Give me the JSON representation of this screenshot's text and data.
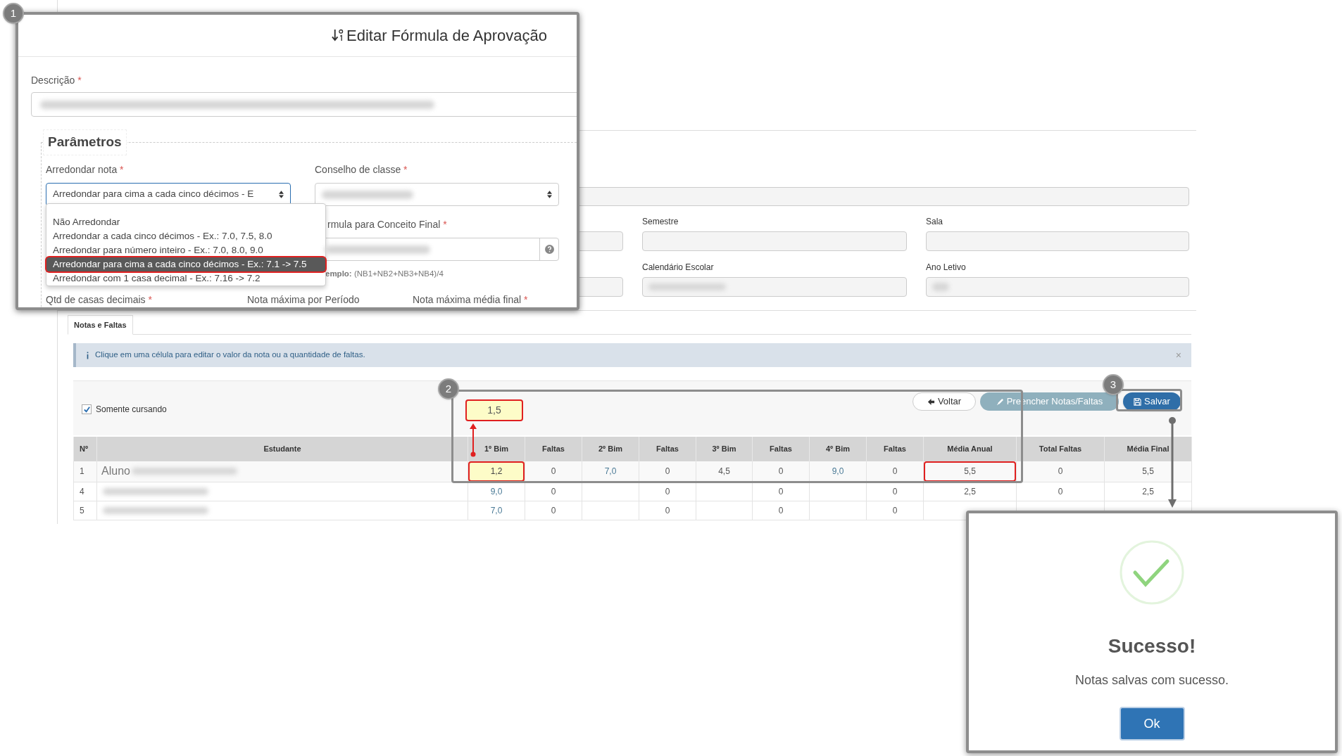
{
  "formula_dialog": {
    "badge": "1",
    "title": "Editar Fórmula de Aprovação",
    "description": {
      "label": "Descrição",
      "required_mark": "*"
    },
    "fieldset": "Parâmetros",
    "rounding": {
      "label": "Arredondar nota",
      "required_mark": "*",
      "value": "Arredondar para cima a cada cinco décimos - E",
      "options": [
        {
          "label": "Não Arredondar",
          "selected": false
        },
        {
          "label": "Arredondar a cada cinco décimos - Ex.: 7.0, 7.5, 8.0",
          "selected": false
        },
        {
          "label": "Arredondar para número inteiro - Ex.: 7.0, 8.0, 9.0",
          "selected": false
        },
        {
          "label": "Arredondar para cima a cada cinco décimos - Ex.: 7.1 -> 7.5",
          "selected": true
        },
        {
          "label": "Arredondar com 1 casa decimal - Ex.: 7.16 -> 7.2",
          "selected": false
        }
      ]
    },
    "class_council": {
      "label": "Conselho de classe",
      "required_mark": "*"
    },
    "final_formula": {
      "label": "rmula para Conceito Final",
      "required_mark": "*",
      "hint": "**emplo:** (NB1+NB2+NB3+NB4)/4"
    },
    "bottom_labels": [
      {
        "label": "Qtd de casas decimais",
        "required_mark": "*"
      },
      {
        "label": "Nota máxima por Período"
      },
      {
        "label": "Nota máxima média final",
        "required_mark": "*"
      }
    ]
  },
  "form": {
    "fields": [
      {
        "label": "Semestre"
      },
      {
        "label": "Sala"
      },
      {
        "label": "Calendário Escolar"
      },
      {
        "label": "Ano Letivo"
      }
    ]
  },
  "tabs": [
    {
      "label": "Notas e Faltas",
      "selected": true
    }
  ],
  "alert": {
    "text": "Clique em uma célula para editar o valor da nota ou a quantidade de faltas.",
    "close": "×"
  },
  "filter": {
    "label": "Somente cursando",
    "checked": true
  },
  "buttons": [
    {
      "label": "Voltar",
      "kind": "default"
    },
    {
      "label": "Preencher Notas/Faltas",
      "kind": "disabled"
    },
    {
      "label": "Salvar",
      "kind": "primary"
    }
  ],
  "callouts": [
    {
      "badge": "2",
      "value": "1,5"
    },
    {
      "badge": "3"
    }
  ],
  "grades_table": {
    "columns": [
      {
        "label": "Nº"
      },
      {
        "label": "Estudante"
      },
      {
        "label": "1º Bim",
        "kind": "link"
      },
      {
        "label": "Faltas",
        "kind": "plain"
      },
      {
        "label": "2º Bim",
        "kind": "link"
      },
      {
        "label": "Faltas",
        "kind": "plain"
      },
      {
        "label": "3º Bim",
        "kind": "plain"
      },
      {
        "label": "Faltas",
        "kind": "plain"
      },
      {
        "label": "4º Bim",
        "kind": "link"
      },
      {
        "label": "Faltas",
        "kind": "plain"
      },
      {
        "label": "Média Anual",
        "kind": "plain"
      },
      {
        "label": "Total Faltas",
        "kind": "plain"
      },
      {
        "label": "Média Final",
        "kind": "plain"
      }
    ],
    "rows": [
      {
        "cells": [
          "1",
          {
            "text": "Aluno",
            "kind": "student"
          },
          {
            "text": "1,2",
            "kind": "editing"
          },
          "0",
          "7,0",
          "0",
          "4,5",
          "0",
          "9,0",
          "0",
          {
            "text": "5,5",
            "kind": "marked"
          },
          "0",
          "5,5"
        ]
      },
      {
        "cells": [
          "4",
          null,
          "9,0",
          "0",
          null,
          "0",
          null,
          "0",
          null,
          "0",
          "2,5",
          "0",
          "2,5"
        ]
      },
      {
        "cells": [
          "5",
          null,
          "7,0",
          "0",
          null,
          "0",
          null,
          "0",
          null,
          "0",
          null,
          null,
          null
        ]
      }
    ]
  },
  "success_dialog": {
    "title": "Sucesso!",
    "message": "Notas salvas com sucesso.",
    "button": "Ok"
  }
}
